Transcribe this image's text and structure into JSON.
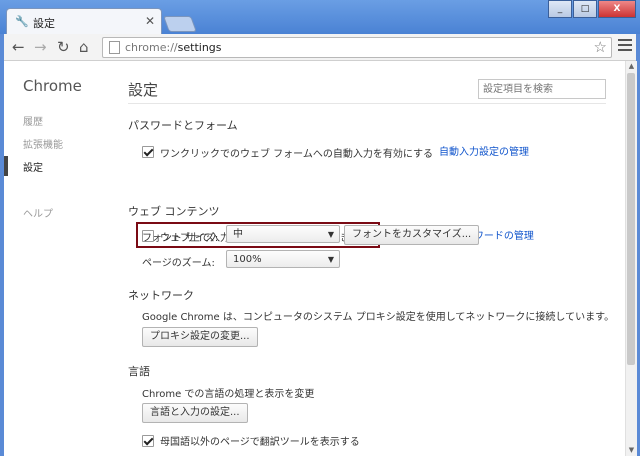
{
  "tab": {
    "title": "設定",
    "close": "✕",
    "icon": "wrench-icon"
  },
  "window": {
    "minimize": "_",
    "maximize": "□",
    "close": "X"
  },
  "omnibox": {
    "url_prefix": "chrome://",
    "url_path": "settings"
  },
  "sidebar": {
    "title": "Chrome",
    "items": [
      {
        "label": "履歴"
      },
      {
        "label": "拡張機能"
      },
      {
        "label": "設定"
      },
      {
        "label": "ヘルプ"
      }
    ]
  },
  "main": {
    "title": "設定",
    "search_placeholder": "設定項目を検索",
    "password": {
      "heading": "パスワードとフォーム",
      "autofill_label": "ワンクリックでのウェブ フォームへの自動入力を有効にする",
      "autofill_link": "自動入力設定の管理",
      "autofill_checked": true,
      "save_pw_label": "ウェブ上で入力したパスワードを保存できるようにする",
      "save_pw_link": "保存したパスワードの管理",
      "save_pw_checked": false
    },
    "web_content": {
      "heading": "ウェブ コンテンツ",
      "font_size_label": "フォント サイズ:",
      "font_size_value": "中",
      "customize_fonts": "フォントをカスタマイズ...",
      "zoom_label": "ページのズーム:",
      "zoom_value": "100%"
    },
    "network": {
      "heading": "ネットワーク",
      "description": "Google Chrome は、コンピュータのシステム プロキシ設定を使用してネットワークに接続しています。",
      "proxy_button": "プロキシ設定の変更..."
    },
    "language": {
      "heading": "言語",
      "description": "Chrome での言語の処理と表示を変更",
      "lang_button": "言語と入力の設定...",
      "translate_label": "母国語以外のページで翻訳ツールを表示する",
      "translate_checked": true
    }
  }
}
